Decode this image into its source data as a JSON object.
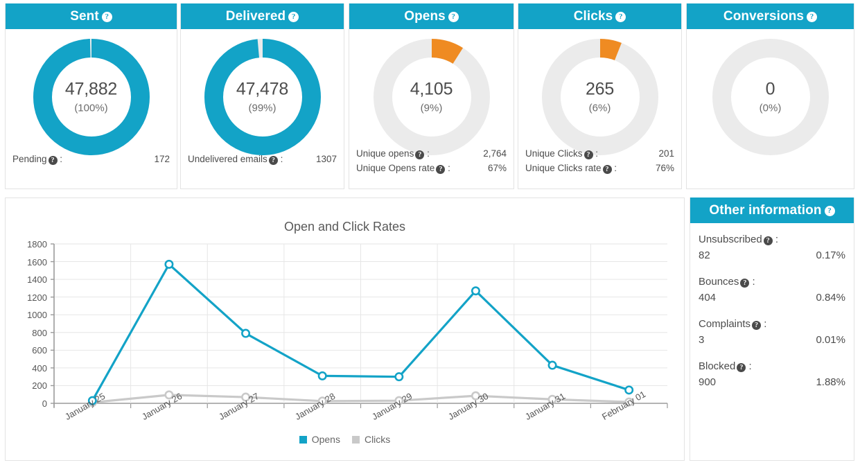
{
  "theme": {
    "accent": "#13a3c7",
    "orange": "#ef8b22",
    "grey_track": "#ebebeb",
    "text": "#4c4c4c",
    "card_border": "#e3e3e3"
  },
  "stat_cards": [
    {
      "title": "Sent",
      "help_icon": "question-mark-icon",
      "value": "47,882",
      "percent": "(100%)",
      "donut": {
        "color": "#13a3c7",
        "filled_percent": 100,
        "track": "#ebebeb"
      },
      "rows": [
        {
          "label": "Pending",
          "help_icon": "question-mark-icon",
          "value": "172"
        }
      ]
    },
    {
      "title": "Delivered",
      "help_icon": "question-mark-icon",
      "value": "47,478",
      "percent": "(99%)",
      "donut": {
        "color": "#13a3c7",
        "filled_percent": 99,
        "track": "#ebebeb"
      },
      "rows": [
        {
          "label": "Undelivered emails",
          "help_icon": "question-mark-icon",
          "value": "1307"
        }
      ]
    },
    {
      "title": "Opens",
      "help_icon": "question-mark-icon",
      "value": "4,105",
      "percent": "(9%)",
      "donut": {
        "color": "#ef8b22",
        "filled_percent": 9,
        "track": "#ebebeb"
      },
      "rows": [
        {
          "label": "Unique opens",
          "help_icon": "question-mark-icon",
          "value": "2,764"
        },
        {
          "label": "Unique Opens rate",
          "help_icon": "question-mark-icon",
          "value": "67%"
        }
      ]
    },
    {
      "title": "Clicks",
      "help_icon": "question-mark-icon",
      "value": "265",
      "percent": "(6%)",
      "donut": {
        "color": "#ef8b22",
        "filled_percent": 6,
        "track": "#ebebeb"
      },
      "rows": [
        {
          "label": "Unique Clicks",
          "help_icon": "question-mark-icon",
          "value": "201"
        },
        {
          "label": "Unique Clicks rate",
          "help_icon": "question-mark-icon",
          "value": "76%"
        }
      ]
    },
    {
      "title": "Conversions",
      "help_icon": "question-mark-icon",
      "value": "0",
      "percent": "(0%)",
      "donut": {
        "color": "#ef8b22",
        "filled_percent": 0,
        "track": "#ebebeb"
      },
      "rows": []
    }
  ],
  "chart_data": {
    "type": "line",
    "title": "Open and Click Rates",
    "xlabel": "",
    "ylabel": "",
    "ylim": [
      0,
      1800
    ],
    "ytick_step": 200,
    "yticks": [
      0,
      200,
      400,
      600,
      800,
      1000,
      1200,
      1400,
      1600,
      1800
    ],
    "grid": true,
    "legend_position": "bottom",
    "categories": [
      "January 25",
      "January 26",
      "January 27",
      "January 28",
      "January 29",
      "January 30",
      "January 31",
      "February 01"
    ],
    "series": [
      {
        "name": "Opens",
        "color": "#13a3c7",
        "values": [
          30,
          1570,
          790,
          310,
          300,
          1270,
          430,
          150
        ]
      },
      {
        "name": "Clicks",
        "color": "#c9c9c9",
        "values": [
          10,
          95,
          70,
          25,
          30,
          85,
          45,
          15
        ]
      }
    ]
  },
  "other_information": {
    "title": "Other information",
    "help_icon": "question-mark-icon",
    "items": [
      {
        "label": "Unsubscribed",
        "help_icon": "question-mark-icon",
        "count": "82",
        "rate": "0.17%"
      },
      {
        "label": "Bounces",
        "help_icon": "question-mark-icon",
        "count": "404",
        "rate": "0.84%"
      },
      {
        "label": "Complaints",
        "help_icon": "question-mark-icon",
        "count": "3",
        "rate": "0.01%"
      },
      {
        "label": "Blocked",
        "help_icon": "question-mark-icon",
        "count": "900",
        "rate": "1.88%"
      }
    ]
  }
}
